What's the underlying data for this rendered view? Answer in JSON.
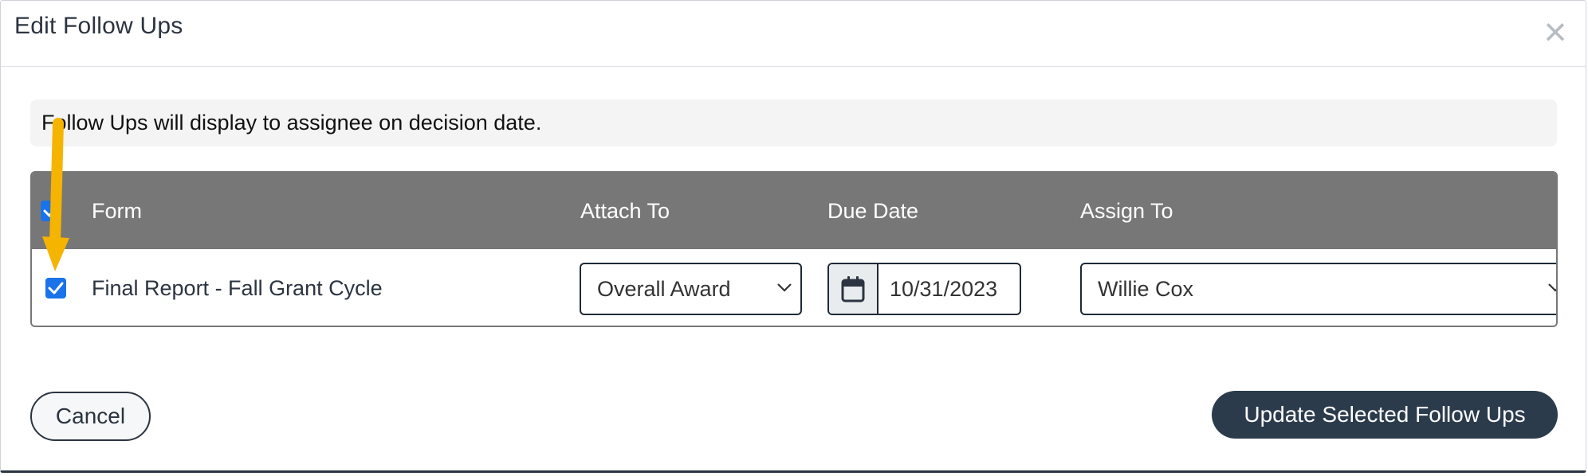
{
  "modal": {
    "title": "Edit Follow Ups",
    "close_label": "×"
  },
  "info": {
    "message": "Follow Ups will display to assignee on decision date."
  },
  "table": {
    "columns": {
      "form": "Form",
      "attach_to": "Attach To",
      "due_date": "Due Date",
      "assign_to": "Assign To"
    },
    "header_checkbox_checked": true,
    "rows": [
      {
        "checked": true,
        "form": "Final Report - Fall Grant Cycle",
        "attach_to": "Overall Award",
        "due_date": "10/31/2023",
        "assign_to": "Willie Cox"
      }
    ]
  },
  "footer": {
    "cancel_label": "Cancel",
    "update_label": "Update Selected Follow Ups"
  },
  "colors": {
    "header_bg": "#777777",
    "primary_button": "#2b3b4c",
    "checkbox": "#1a73e8",
    "annotation_arrow": "#f5b400"
  },
  "icons": {
    "close": "close-icon",
    "calendar": "calendar-icon",
    "chevron": "chevron-down-icon",
    "check": "check-icon",
    "arrow": "annotation-arrow-icon"
  }
}
